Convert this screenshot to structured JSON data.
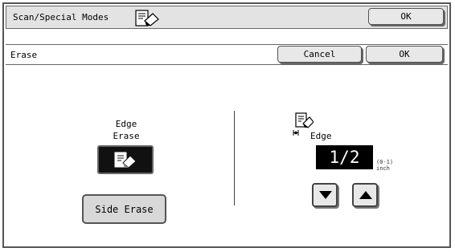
{
  "header": {
    "title": "Scan/Special Modes",
    "icon": "scan-special-modes-icon",
    "ok_label": "OK"
  },
  "subheader": {
    "title": "Erase",
    "cancel_label": "Cancel",
    "ok_label": "OK"
  },
  "left": {
    "edge_erase_label_line1": "Edge",
    "edge_erase_label_line2": "Erase",
    "edge_erase_icon": "edge-erase-icon",
    "side_erase_label": "Side Erase"
  },
  "right": {
    "edge_label": "Edge",
    "edge_icon": "edge-erase-icon",
    "value": "1/2",
    "range_line1": "(0-1)",
    "range_line2": "inch",
    "down_icon": "arrow-down-icon",
    "up_icon": "arrow-up-icon"
  }
}
